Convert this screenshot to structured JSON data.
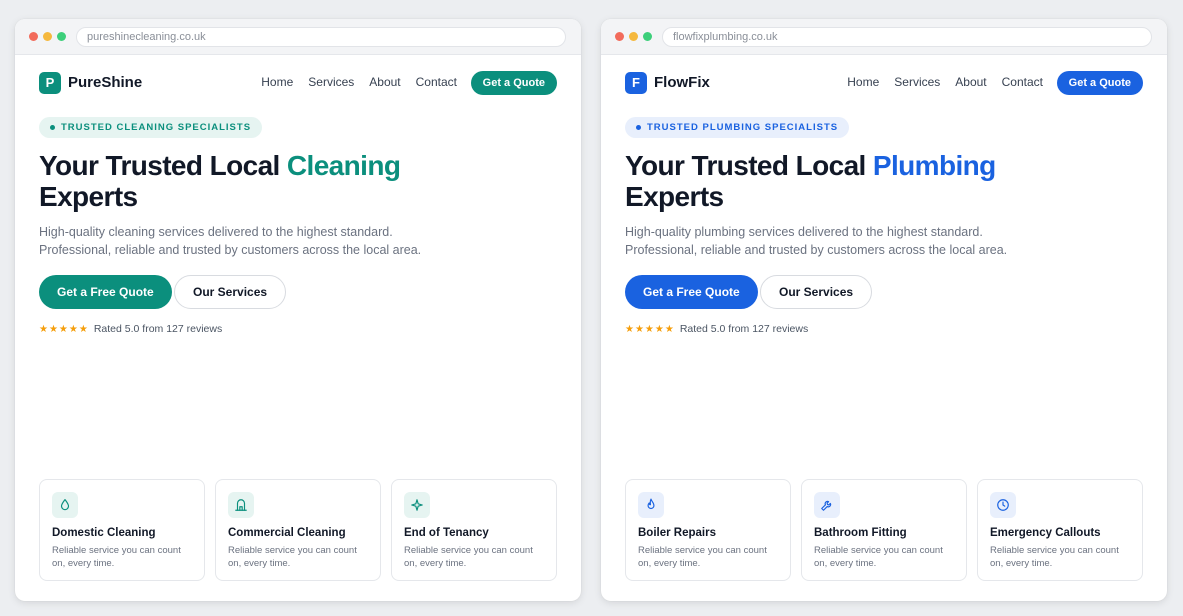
{
  "windows": [
    {
      "url": "pureshinecleaning.co.uk",
      "logo_letter": "P",
      "brand": "PureShine",
      "nav_links": [
        "Home",
        "Services",
        "About",
        "Contact"
      ],
      "quote_label": "Get a Quote",
      "badge": "TRUSTED CLEANING SPECIALISTS",
      "title_prefix": "Your Trusted Local ",
      "title_highlight": "Cleaning",
      "title_suffix": "Experts",
      "desc_line1": "High-quality cleaning services delivered to the highest standard.",
      "desc_line2": "Professional, reliable and trusted by customers across the local area.",
      "primary_cta": "Get a Free Quote",
      "secondary_cta": "Our Services",
      "stars": "★★★★★",
      "rating_text": "Rated 5.0 from 127 reviews",
      "accent": "#0b8f7d",
      "accent_soft": "#e6f4f1",
      "cards": [
        {
          "icon": "droplet-icon",
          "title": "Domestic Cleaning",
          "text": "Reliable service you can count on, every time."
        },
        {
          "icon": "building-icon",
          "title": "Commercial Cleaning",
          "text": "Reliable service you can count on, every time."
        },
        {
          "icon": "sparkle-icon",
          "title": "End of Tenancy",
          "text": "Reliable service you can count on, every time."
        }
      ]
    },
    {
      "url": "flowfixplumbing.co.uk",
      "logo_letter": "F",
      "brand": "FlowFix",
      "nav_links": [
        "Home",
        "Services",
        "About",
        "Contact"
      ],
      "quote_label": "Get a Quote",
      "badge": "TRUSTED PLUMBING SPECIALISTS",
      "title_prefix": "Your Trusted Local ",
      "title_highlight": "Plumbing",
      "title_suffix": "Experts",
      "desc_line1": "High-quality plumbing services delivered to the highest standard.",
      "desc_line2": "Professional, reliable and trusted by customers across the local area.",
      "primary_cta": "Get a Free Quote",
      "secondary_cta": "Our Services",
      "stars": "★★★★★",
      "rating_text": "Rated 5.0 from 127 reviews",
      "accent": "#1a62e0",
      "accent_soft": "#e8effc",
      "cards": [
        {
          "icon": "flame-icon",
          "title": "Boiler Repairs",
          "text": "Reliable service you can count on, every time."
        },
        {
          "icon": "wrench-icon",
          "title": "Bathroom Fitting",
          "text": "Reliable service you can count on, every time."
        },
        {
          "icon": "clock-icon",
          "title": "Emergency Callouts",
          "text": "Reliable service you can count on, every time."
        }
      ]
    }
  ]
}
